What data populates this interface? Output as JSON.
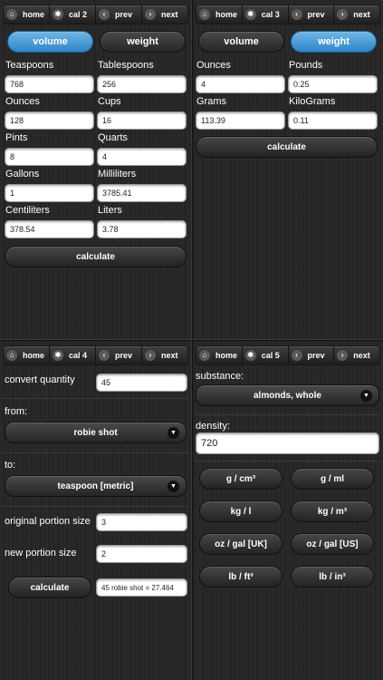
{
  "panel1": {
    "nav": {
      "home": "home",
      "cal": "cal 2",
      "prev": "prev",
      "next": "next"
    },
    "tab_volume": "volume",
    "tab_weight": "weight",
    "fields": [
      {
        "label": "Teaspoons",
        "value": "768"
      },
      {
        "label": "Tablespoons",
        "value": "256"
      },
      {
        "label": "Ounces",
        "value": "128"
      },
      {
        "label": "Cups",
        "value": "16"
      },
      {
        "label": "Pints",
        "value": "8"
      },
      {
        "label": "Quarts",
        "value": "4"
      },
      {
        "label": "Gallons",
        "value": "1"
      },
      {
        "label": "Milliliters",
        "value": "3785.41"
      },
      {
        "label": "Centiliters",
        "value": "378.54"
      },
      {
        "label": "Liters",
        "value": "3.78"
      }
    ],
    "calculate": "calculate"
  },
  "panel2": {
    "nav": {
      "home": "home",
      "cal": "cal 3",
      "prev": "prev",
      "next": "next"
    },
    "tab_volume": "volume",
    "tab_weight": "weight",
    "fields": [
      {
        "label": "Ounces",
        "value": "4"
      },
      {
        "label": "Pounds",
        "value": "0.25"
      },
      {
        "label": "Grams",
        "value": "113.39"
      },
      {
        "label": "KiloGrams",
        "value": "0.11"
      }
    ],
    "calculate": "calculate"
  },
  "panel3": {
    "nav": {
      "home": "home",
      "cal": "cal 4",
      "prev": "prev",
      "next": "next"
    },
    "quantity_label": "convert quantity",
    "quantity_value": "45",
    "from_label": "from:",
    "from_value": "robie shot",
    "to_label": "to:",
    "to_value": "teaspoon [metric]",
    "original_label": "original portion size",
    "original_value": "3",
    "new_label": "new portion size",
    "new_value": "2",
    "calculate": "calculate",
    "result": "45 robie shot = 27.464"
  },
  "panel4": {
    "nav": {
      "home": "home",
      "cal": "cal 5",
      "prev": "prev",
      "next": "next"
    },
    "substance_label": "substance:",
    "substance_value": "almonds, whole",
    "density_label": "density:",
    "density_value": "720",
    "units": [
      "g / cm³",
      "g / ml",
      "kg / l",
      "kg / m³",
      "oz / gal [UK]",
      "oz / gal [US]",
      "lb / ft³",
      "lb / in³"
    ]
  },
  "colors": {
    "accent": "#3a8fd0",
    "background": "#282828"
  }
}
